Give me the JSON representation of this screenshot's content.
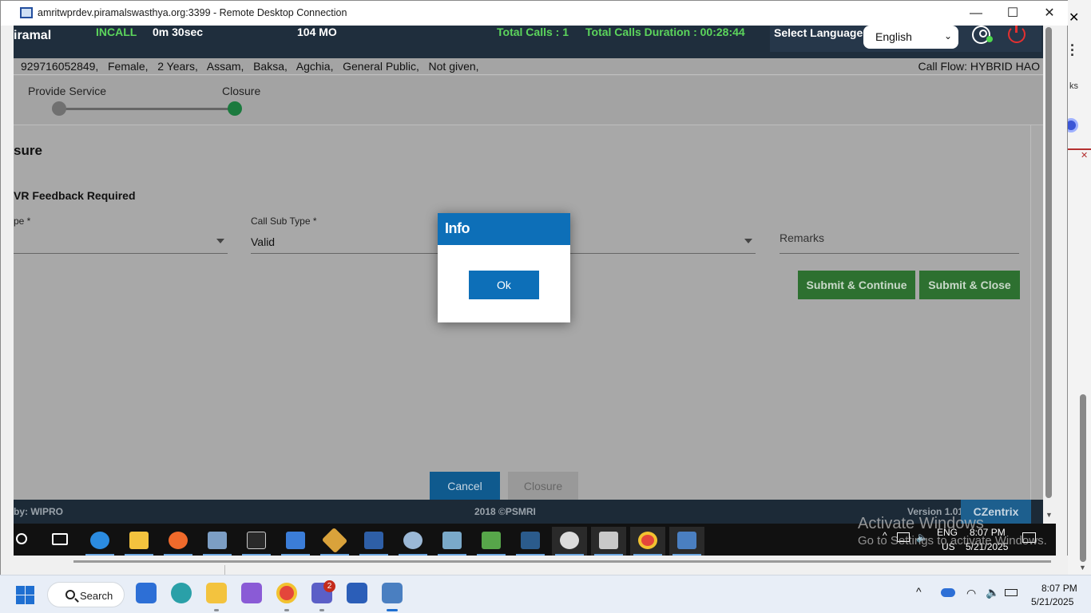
{
  "rdp_window": {
    "title": "amritwprdev.piramalswasthya.org:3399 - Remote Desktop Connection",
    "minimize": "—",
    "maximize": "☐",
    "close": "✕"
  },
  "header": {
    "brand": "iramal",
    "call_status": "INCALL",
    "call_timer": "0m 30sec",
    "service": "104 MO",
    "total_calls": "Total Calls : 1",
    "total_duration": "Total Calls Duration : 00:28:44",
    "select_language_label": "Select Language:",
    "language_value": "English"
  },
  "caller_info": {
    "items": "929716052849,   Female,   2 Years,   Assam,   Baksa,   Agchia,   General Public,   Not given,",
    "call_flow": "Call Flow: HYBRID HAO"
  },
  "stepper": {
    "step1": "Provide Service",
    "step2": "Closure",
    "step1_color": "#707070",
    "step2_color": "#1b7a3e"
  },
  "closure_form": {
    "heading": "sure",
    "ivr_label": "VR Feedback Required",
    "type_label": "pe *",
    "sub_type_label": "Call Sub Type *",
    "sub_type_value": "Valid",
    "remarks_placeholder": "Remarks",
    "submit_continue": "Submit & Continue",
    "submit_close": "Submit & Close",
    "cancel": "Cancel",
    "closure": "Closure"
  },
  "footer": {
    "powered_by": "by: WIPRO",
    "copyright": "2018 ©PSMRI",
    "version": "Version 1.01",
    "czentrix": "CZentrix"
  },
  "dialog": {
    "title": "Info",
    "ok_label": "Ok"
  },
  "remote_taskbar": {
    "lang": "ENG",
    "region": "US",
    "time": "8:07 PM",
    "date": "5/21/2025",
    "watermark_title": "Activate Windows",
    "watermark_sub": "Go to Settings to activate Windows."
  },
  "host_taskbar": {
    "search_label": "Search",
    "teams_badge": "2",
    "time": "8:07 PM",
    "date": "5/21/2025"
  },
  "host_desktop": {
    "side_text": "ks"
  },
  "colors": {
    "accent_blue": "#0d6fb8",
    "green_button": "#2d7030",
    "incall_green": "#5cd55c",
    "topbar": "#1f2e3d"
  }
}
